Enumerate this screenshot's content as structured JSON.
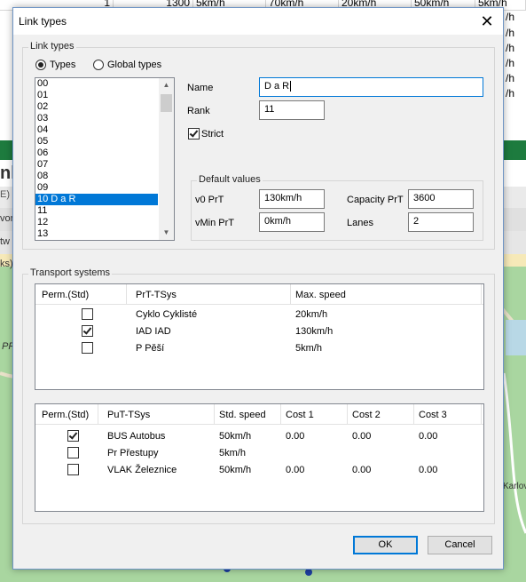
{
  "background": {
    "table_row": [
      "1",
      "1300",
      "5km/h",
      "70km/h",
      "20km/h",
      "50km/h",
      "5km/h"
    ],
    "side_units": [
      "/h",
      "/h",
      "/h",
      "/h",
      "/h",
      "/h"
    ],
    "side_left_texts": [
      "nl",
      "E)",
      "vor",
      "tw",
      "ks)",
      "PR"
    ],
    "map_label": "Karlov",
    "accent_green": "#1d7b3e",
    "map_green": "#a9d6a0"
  },
  "dialog": {
    "title": "Link types",
    "close_label": "✕",
    "link_types_group": "Link types",
    "radio_types": "Types",
    "radio_global": "Global types",
    "list_items": [
      "00",
      "01",
      "02",
      "03",
      "04",
      "05",
      "06",
      "07",
      "08",
      "09",
      "10 D a R",
      "11",
      "12",
      "13"
    ],
    "selected_index": 10,
    "name_label": "Name",
    "name_value": "D a R",
    "rank_label": "Rank",
    "rank_value": "11",
    "strict_label": "Strict",
    "strict_checked": true,
    "defaults_group": "Default values",
    "v0_label": "v0 PrT",
    "v0_value": "130km/h",
    "capacity_label": "Capacity PrT",
    "capacity_value": "3600",
    "vmin_label": "vMin PrT",
    "vmin_value": "0km/h",
    "lanes_label": "Lanes",
    "lanes_value": "2",
    "transport_group": "Transport systems",
    "prt": {
      "headers": [
        "Perm.(Std)",
        "PrT-TSys",
        "Max. speed"
      ],
      "rows": [
        {
          "checked": false,
          "tsys": "Cyklo Cyklisté",
          "speed": "20km/h"
        },
        {
          "checked": true,
          "tsys": "IAD IAD",
          "speed": "130km/h"
        },
        {
          "checked": false,
          "tsys": "P Pěší",
          "speed": "5km/h"
        }
      ]
    },
    "put": {
      "headers": [
        "Perm.(Std)",
        "PuT-TSys",
        "Std. speed",
        "Cost 1",
        "Cost 2",
        "Cost 3"
      ],
      "rows": [
        {
          "checked": true,
          "tsys": "BUS Autobus",
          "speed": "50km/h",
          "c1": "0.00",
          "c2": "0.00",
          "c3": "0.00"
        },
        {
          "checked": false,
          "tsys": "Pr Přestupy",
          "speed": "5km/h",
          "c1": "",
          "c2": "",
          "c3": ""
        },
        {
          "checked": false,
          "tsys": "VLAK Železnice",
          "speed": "50km/h",
          "c1": "0.00",
          "c2": "0.00",
          "c3": "0.00"
        }
      ]
    },
    "ok_label": "OK",
    "cancel_label": "Cancel",
    "selection_color": "#0078d7"
  }
}
